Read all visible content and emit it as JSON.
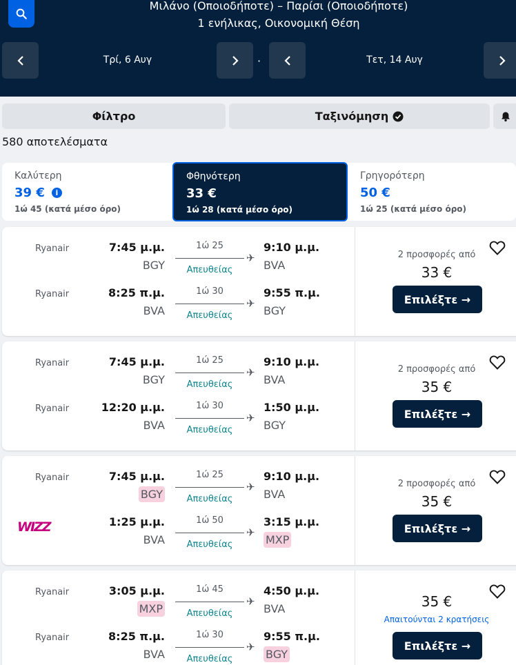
{
  "header": {
    "route": "Μιλάνο (Οποιοδήποτε) – Παρίσι (Οποιοδήποτε)",
    "passengers": "1 ενήλικας, Οικονομική Θέση",
    "depart_date": "Τρί, 6 Αυγ",
    "return_date": "Τετ, 14 Αυγ",
    "separator": "·"
  },
  "controls": {
    "filter": "Φίλτρο",
    "sort": "Ταξινόμηση"
  },
  "results_count": "580 αποτελέσματα",
  "tabs": [
    {
      "label": "Καλύτερη",
      "price": "39 €",
      "duration": "1ώ 45 (κατά μέσο όρο)"
    },
    {
      "label": "Φθηνότερη",
      "price": "33 €",
      "duration": "1ώ 28 (κατά μέσο όρο)"
    },
    {
      "label": "Γρηγορότερη",
      "price": "50 €",
      "duration": "1ώ 25 (κατά μέσο όρο)"
    }
  ],
  "results": [
    {
      "legs": [
        {
          "airline": "Ryanair",
          "dep_time": "7:45 μ.μ.",
          "dep_code": "BGY",
          "arr_time": "9:10 μ.μ.",
          "arr_code": "BVA",
          "duration": "1ώ 25",
          "stops": "Απευθείας"
        },
        {
          "airline": "Ryanair",
          "dep_time": "8:25 π.μ.",
          "dep_code": "BVA",
          "arr_time": "9:55 π.μ.",
          "arr_code": "BGY",
          "duration": "1ώ 30",
          "stops": "Απευθείας"
        }
      ],
      "offers": "2 προσφορές από",
      "price": "33 €",
      "select": "Επιλέξτε →"
    },
    {
      "legs": [
        {
          "airline": "Ryanair",
          "dep_time": "7:45 μ.μ.",
          "dep_code": "BGY",
          "arr_time": "9:10 μ.μ.",
          "arr_code": "BVA",
          "duration": "1ώ 25",
          "stops": "Απευθείας"
        },
        {
          "airline": "Ryanair",
          "dep_time": "12:20 μ.μ.",
          "dep_code": "BVA",
          "arr_time": "1:50 μ.μ.",
          "arr_code": "BGY",
          "duration": "1ώ 30",
          "stops": "Απευθείας"
        }
      ],
      "offers": "2 προσφορές από",
      "price": "35 €",
      "select": "Επιλέξτε →"
    },
    {
      "legs": [
        {
          "airline": "Ryanair",
          "dep_time": "7:45 μ.μ.",
          "dep_code": "BGY",
          "arr_time": "9:10 μ.μ.",
          "arr_code": "BVA",
          "duration": "1ώ 25",
          "stops": "Απευθείας"
        },
        {
          "airline": "WIZZ",
          "dep_time": "1:25 μ.μ.",
          "dep_code": "BVA",
          "arr_time": "3:15 μ.μ.",
          "arr_code": "MXP",
          "duration": "1ώ 50",
          "stops": "Απευθείας"
        }
      ],
      "offers": "2 προσφορές από",
      "price": "35 €",
      "select": "Επιλέξτε →"
    },
    {
      "legs": [
        {
          "airline": "Ryanair",
          "dep_time": "3:05 μ.μ.",
          "dep_code": "MXP",
          "arr_time": "4:50 μ.μ.",
          "arr_code": "BVA",
          "duration": "1ώ 45",
          "stops": "Απευθείας"
        },
        {
          "airline": "Ryanair",
          "dep_time": "8:25 π.μ.",
          "dep_code": "BVA",
          "arr_time": "9:55 π.μ.",
          "arr_code": "BGY",
          "duration": "1ώ 30",
          "stops": "Απευθείας"
        }
      ],
      "price": "35 €",
      "warning": "Απαιτούνται 2 κρατήσεις",
      "select": "Επιλέξτε →"
    }
  ],
  "colors": {
    "header_bg": "#05203c",
    "accent": "#0062e3",
    "direct": "#0c838a",
    "highlight": "#f8d1df"
  }
}
